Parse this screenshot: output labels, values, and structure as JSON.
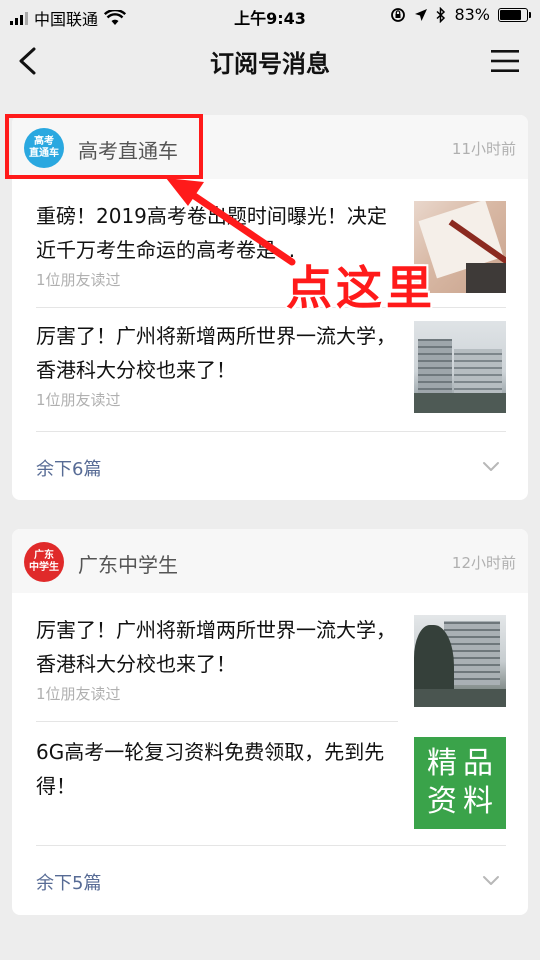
{
  "status_bar": {
    "carrier": "中国联通",
    "time": "上午9:43",
    "battery": "83%",
    "battery_level": 0.83
  },
  "nav": {
    "title": "订阅号消息"
  },
  "cards": [
    {
      "account": {
        "name": "高考直通车",
        "logo_text": [
          "高考",
          "直通车"
        ],
        "logo_color": "#2aa8e0",
        "time": "11小时前"
      },
      "articles": [
        {
          "title": "重磅！2019高考卷出题时间曝光！决定近千万考生命运的高考卷是...",
          "readers": "1位朋友读过"
        },
        {
          "title": "厉害了！广州将新增两所世界一流大学，香港科大分校也来了！",
          "readers": "1位朋友读过"
        }
      ],
      "remaining": "余下6篇"
    },
    {
      "account": {
        "name": "广东中学生",
        "logo_text": [
          "广东",
          "中学生"
        ],
        "logo_color": "#e02a2a",
        "time": "12小时前"
      },
      "articles": [
        {
          "title": "厉害了！广州将新增两所世界一流大学，香港科大分校也来了！",
          "readers": "1位朋友读过"
        },
        {
          "title": "6G高考一轮复习资料免费领取，先到先得！",
          "thumb_text": [
            "精品",
            "资料"
          ]
        }
      ],
      "remaining": "余下5篇"
    }
  ],
  "annotation": {
    "text": "点这里",
    "color": "#ff1a1a"
  }
}
